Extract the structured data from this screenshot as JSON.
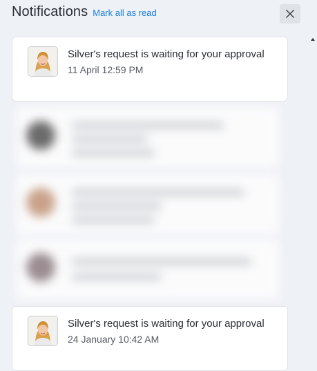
{
  "header": {
    "title": "Notifications",
    "mark_all_label": "Mark all as read"
  },
  "icons": {
    "close": "close-icon",
    "avatar": "avatar-photo"
  },
  "colors": {
    "link": "#1a7fd9",
    "panel_bg": "#eef1f6",
    "card_bg": "#ffffff"
  },
  "notifications": [
    {
      "message": "Silver's request is waiting for your approval",
      "time": "11 April 12:59 PM"
    },
    {
      "message": "Silver's request is waiting for your approval",
      "time": "24 January 10:42 AM"
    }
  ]
}
